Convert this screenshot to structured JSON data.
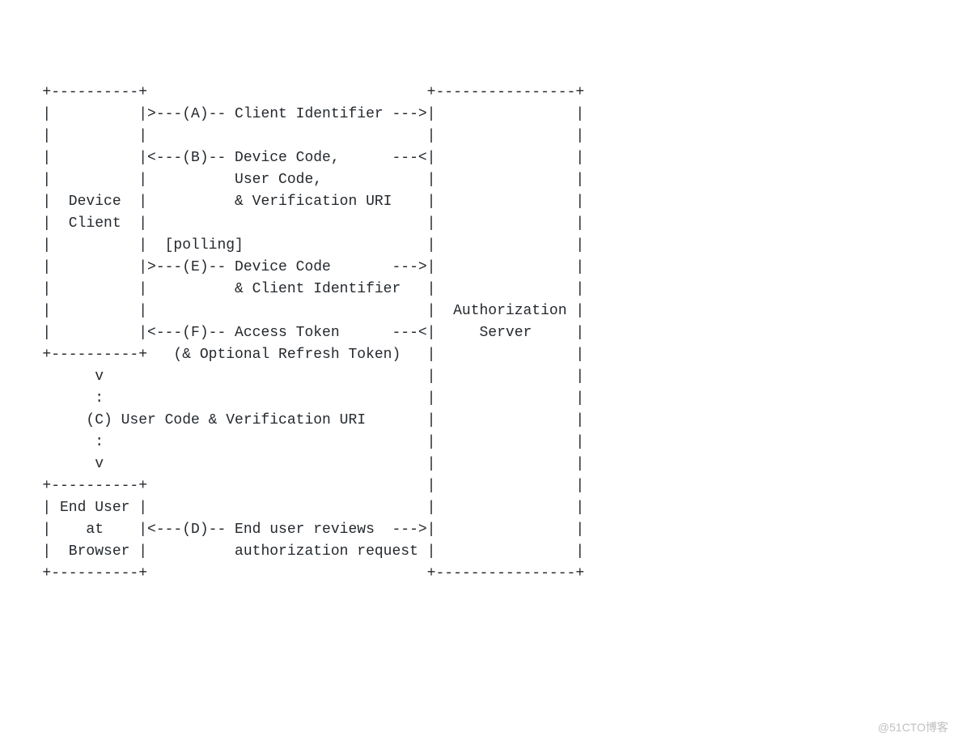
{
  "diagram": {
    "lines": [
      "   +----------+                                +----------------+",
      "   |          |>---(A)-- Client Identifier --->|                |",
      "   |          |                                |                |",
      "   |          |<---(B)-- Device Code,      ---<|                |",
      "   |          |          User Code,            |                |",
      "   |  Device  |          & Verification URI    |                |",
      "   |  Client  |                                |                |",
      "   |          |  [polling]                     |                |",
      "   |          |>---(E)-- Device Code       --->|                |",
      "   |          |          & Client Identifier   |                |",
      "   |          |                                |  Authorization |",
      "   |          |<---(F)-- Access Token      ---<|     Server     |",
      "   +----------+   (& Optional Refresh Token)   |                |",
      "         v                                     |                |",
      "         :                                     |                |",
      "        (C) User Code & Verification URI       |                |",
      "         :                                     |                |",
      "         v                                     |                |",
      "   +----------+                                |                |",
      "   | End User |                                |                |",
      "   |    at    |<---(D)-- End user reviews  --->|                |",
      "   |  Browser |          authorization request |                |",
      "   +----------+                                +----------------+"
    ]
  },
  "entities": {
    "device_client": "Device Client",
    "end_user": "End User at Browser",
    "auth_server": "Authorization Server"
  },
  "flows": {
    "A": "Client Identifier",
    "B": "Device Code, User Code, & Verification URI",
    "C": "User Code & Verification URI",
    "D": "End user reviews authorization request",
    "E": "Device Code & Client Identifier",
    "F": "Access Token (& Optional Refresh Token)",
    "annotation_polling": "[polling]"
  },
  "watermark": "@51CTO博客"
}
